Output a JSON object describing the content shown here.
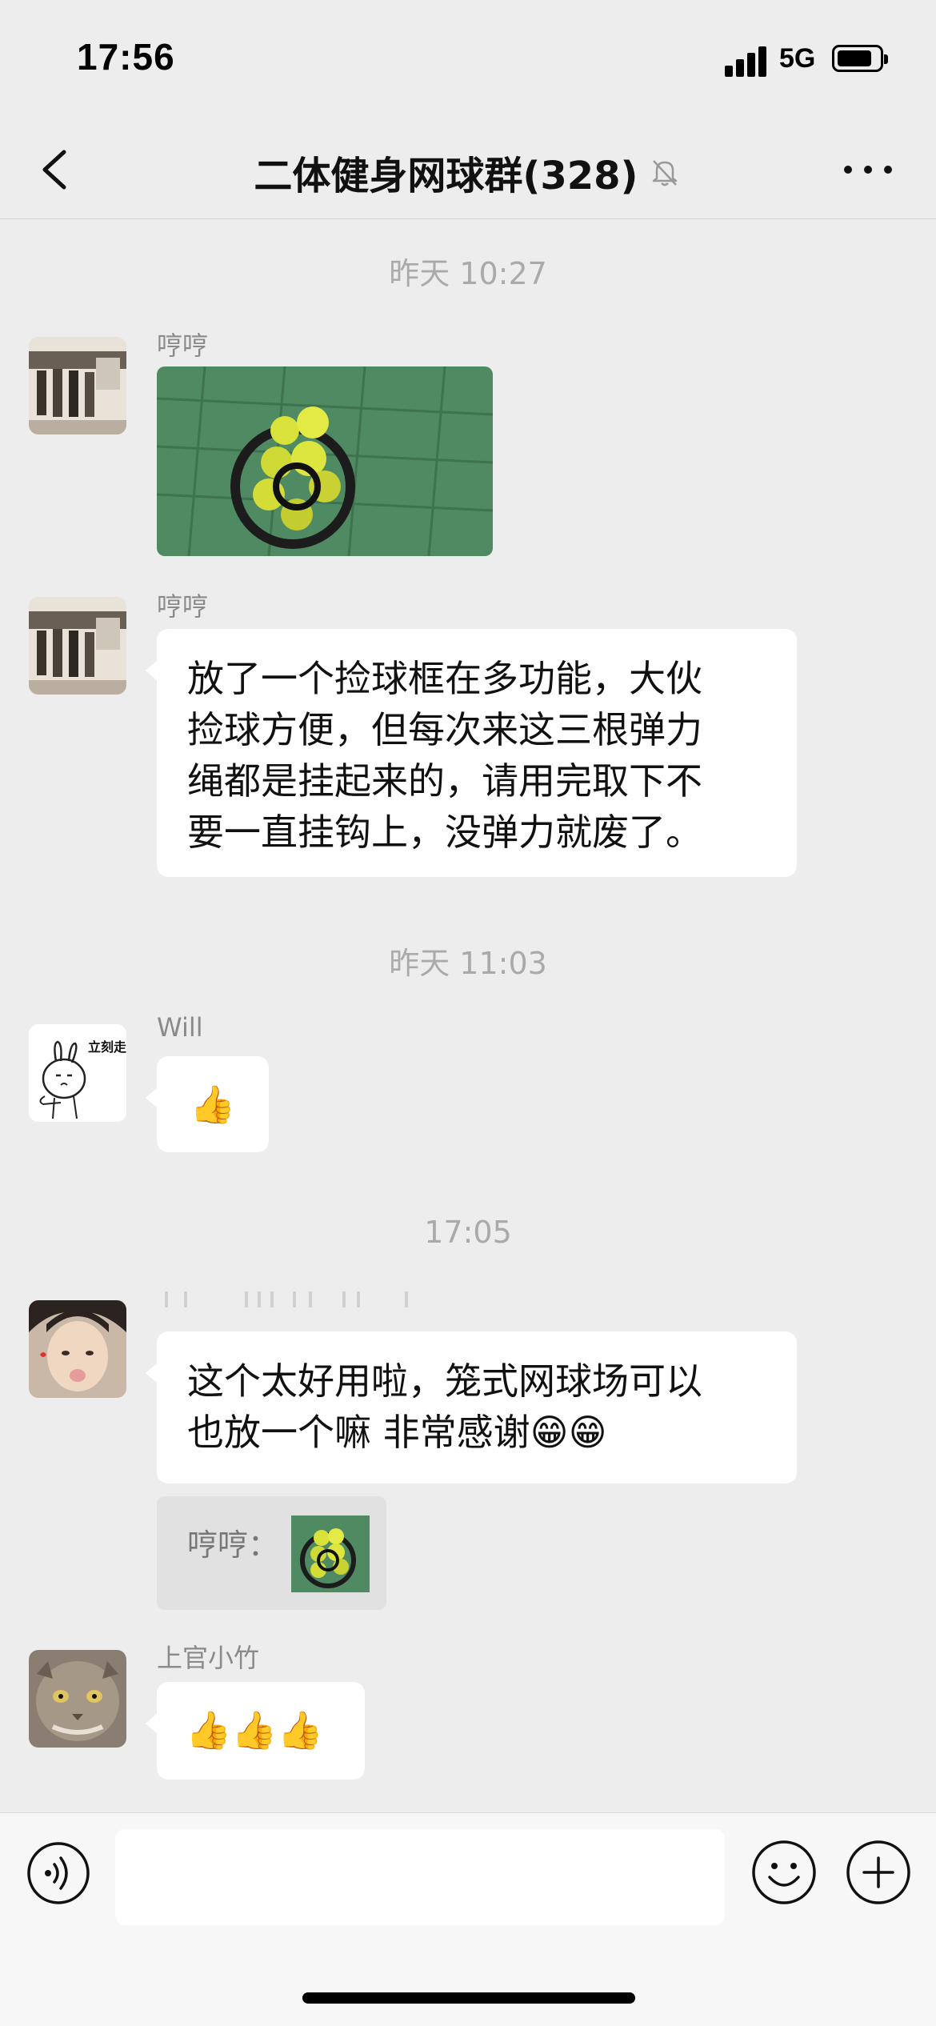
{
  "status_bar": {
    "time": "17:56",
    "network": "5G"
  },
  "header": {
    "title": "二体健身网球群(328)"
  },
  "messages": {
    "ts1": "昨天 10:27",
    "m1": {
      "sender": "哼哼"
    },
    "m2": {
      "sender": "哼哼",
      "lines": [
        "放了一个捡球框在多功能，大伙",
        "捡球方便，但每次来这三根弹力",
        "绳都是挂起来的，请用完取下不",
        "要一直挂钩上，没弹力就废了。"
      ]
    },
    "ts2": "昨天 11:03",
    "m3": {
      "sender": "Will",
      "text": "👍"
    },
    "ts3": "17:05",
    "m4": {
      "lines": [
        "这个太好用啦，笼式网球场可以",
        "也放一个嘛 非常感谢😁😁"
      ],
      "quote_label": "哼哼："
    },
    "m5": {
      "sender": "上官小竹",
      "text": "👍👍👍"
    }
  },
  "avatar_texts": {
    "will_sticker": "立刻走"
  },
  "icons": {
    "back": "chevron-left-icon",
    "mute": "bell-slash-icon",
    "more": "more-dots-icon",
    "voice": "voice-icon",
    "emoji": "emoji-icon",
    "plus": "plus-circle-icon"
  },
  "colors": {
    "background": "#ededed",
    "bubble": "#ffffff",
    "timestamp": "#aaaaaa",
    "sender": "#8a8a8a"
  }
}
